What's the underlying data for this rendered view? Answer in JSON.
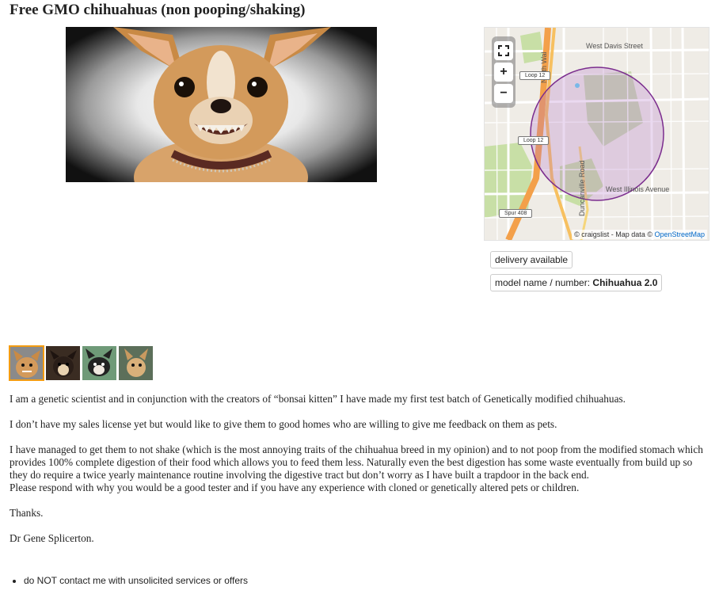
{
  "posting": {
    "title": "Free GMO chihuahuas (non pooping/shaking)"
  },
  "map": {
    "labels": {
      "west_davis": "West Davis Street",
      "north_walton": "North Wal",
      "loop12_a": "Loop 12",
      "loop12_b": "Loop 12",
      "duncanville": "Duncanville Road",
      "west_illinois": "West Illinois Avenue",
      "spur408": "Spur 408"
    },
    "attribution_prefix": "© craigslist - Map data © ",
    "attribution_link": "OpenStreetMap",
    "controls": {
      "fullscreen_icon": "fullscreen-icon",
      "zoom_in": "+",
      "zoom_out": "−"
    }
  },
  "attributes": {
    "delivery": "delivery available",
    "model_label": "model name / number: ",
    "model_value": "Chihuahua 2.0"
  },
  "thumbnails": {
    "count": 4,
    "selected_index": 0
  },
  "body": {
    "p1": "I am a genetic scientist and in conjunction with the creators of “bonsai kitten” I have made my first test batch of Genetically modified chihuahuas.",
    "p2": "I don’t have my sales license yet but would like to give them to good homes who are willing to give me feedback on them as pets.",
    "p3a": "I have managed to get them to not shake (which is the most annoying traits of the chihuahua breed in my opinion) and to not poop from the modified stomach which provides 100% complete digestion of their food which allows you to feed them less. Naturally even the best digestion has some waste eventually from build up so they do require a twice yearly maintenance routine involving the digestive tract but don’t worry as I have built a trapdoor in the back end.",
    "p3b": "Please respond with why you would be a good tester and if you have any experience with cloned or genetically altered pets or children.",
    "p4": "Thanks.",
    "p5": "Dr Gene Splicerton."
  },
  "notices": [
    "do NOT contact me with unsolicited services or offers"
  ],
  "colors": {
    "selected_thumb_border": "#f39c12",
    "link": "#0068c9",
    "map_circle": "#7b2d8e"
  }
}
